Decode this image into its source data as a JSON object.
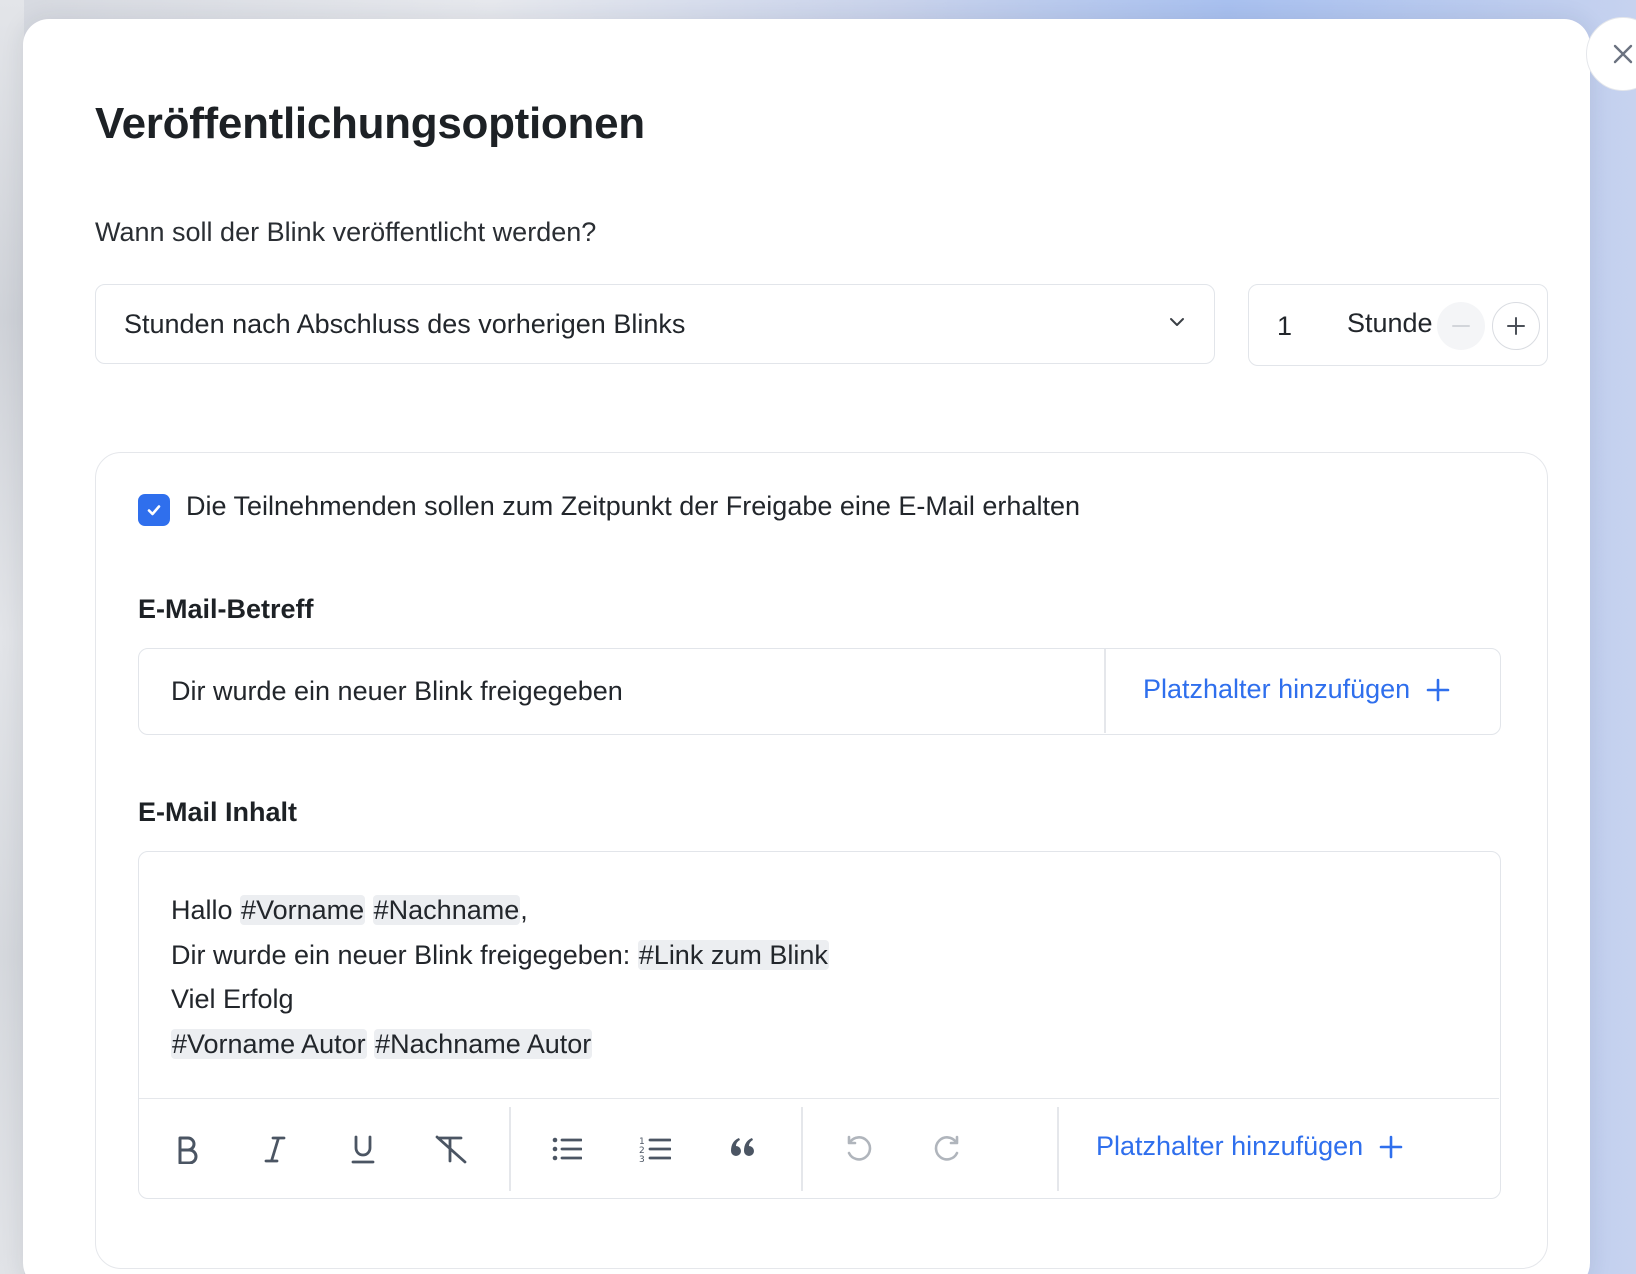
{
  "modal": {
    "title": "Veröffentlichungsoptionen",
    "close_icon": "close-icon"
  },
  "schedule": {
    "question": "Wann soll der Blink veröffentlicht werden?",
    "mode_selected": "Stunden nach Abschluss des vorherigen Blinks",
    "amount": "1",
    "unit": "Stunde"
  },
  "email": {
    "checkbox_checked": true,
    "checkbox_label": "Die Teilnehmenden sollen zum Zeitpunkt der Freigabe eine E-Mail erhalten",
    "subject_label": "E-Mail-Betreff",
    "subject_value": "Dir wurde ein neuer Blink freigegeben",
    "add_placeholder_label": "Platzhalter hinzufügen",
    "content_label": "E-Mail Inhalt",
    "body": {
      "line1_text": "Hallo",
      "line1_tag1": "#Vorname",
      "line1_tag2": "#Nachname",
      "line1_end": ",",
      "line2_text": "Dir wurde ein neuer Blink freigegeben:",
      "line2_tag": "#Link zum Blink",
      "line3_text": "Viel Erfolg",
      "line4_tag1": "#Vorname Autor",
      "line4_tag2": "#Nachname Autor"
    }
  },
  "toolbar": {
    "tools": [
      "bold",
      "italic",
      "underline",
      "clear-format",
      "bullet-list",
      "numbered-list",
      "quote",
      "undo",
      "redo"
    ],
    "add_placeholder_label": "Platzhalter hinzufügen"
  },
  "colors": {
    "accent": "#2f6fed",
    "border": "#e2e5ea",
    "tag_bg": "#eceef1"
  }
}
